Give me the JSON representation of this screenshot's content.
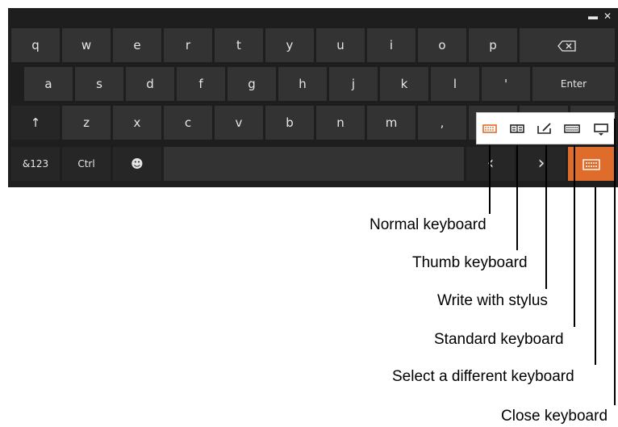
{
  "window": {
    "minimize_glyph": "▬",
    "close_glyph": "✕"
  },
  "keyboard": {
    "row1": [
      "q",
      "w",
      "e",
      "r",
      "t",
      "y",
      "u",
      "i",
      "o",
      "p"
    ],
    "row2": [
      "a",
      "s",
      "d",
      "f",
      "g",
      "h",
      "j",
      "k",
      "l",
      "'"
    ],
    "enter_label": "Enter",
    "shift_glyph": "↑",
    "row3": [
      "z",
      "x",
      "c",
      "v",
      "b",
      "n",
      "m",
      ","
    ],
    "symbols_label": "&123",
    "ctrl_label": "Ctrl",
    "emoji_glyph": "☻",
    "left_glyph": "‹",
    "right_glyph": "›"
  },
  "popup": {
    "icons": [
      "normal-keyboard-icon",
      "thumb-keyboard-icon",
      "write-with-stylus-icon",
      "standard-keyboard-icon",
      "close-keyboard-icon"
    ]
  },
  "colors": {
    "accent": "#e06c2b",
    "key": "#333333",
    "background": "#1e1e1e"
  },
  "callouts": {
    "normal": "Normal keyboard",
    "thumb": "Thumb keyboard",
    "stylus": "Write with stylus",
    "standard": "Standard keyboard",
    "different": "Select a different keyboard",
    "close": "Close keyboard"
  }
}
